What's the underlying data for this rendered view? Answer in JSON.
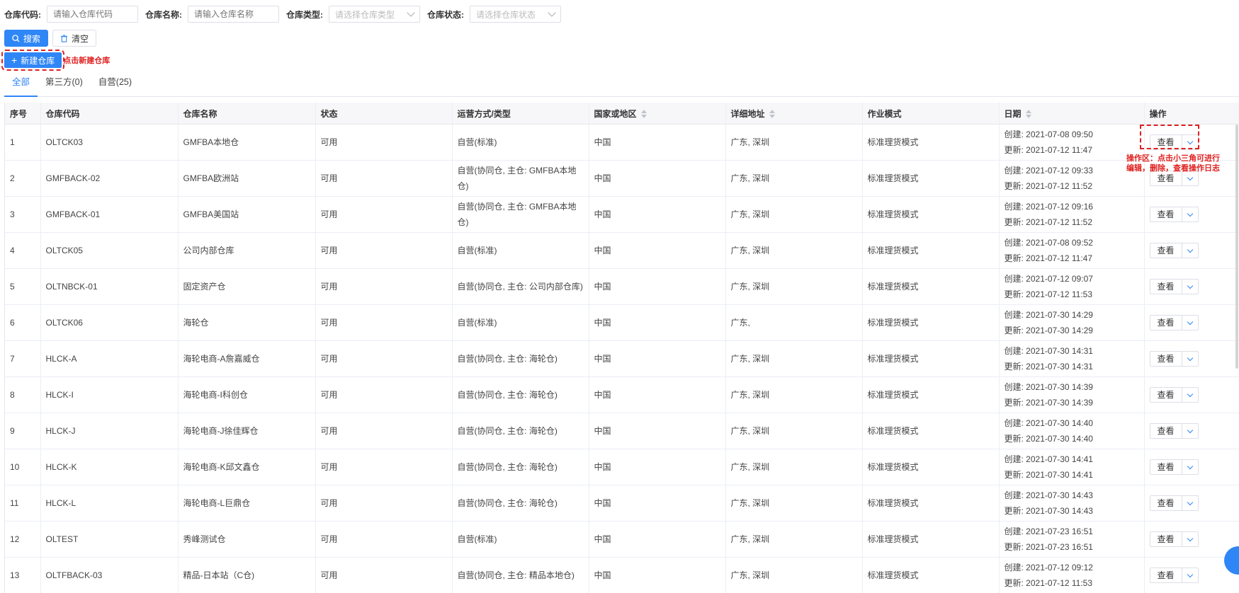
{
  "filters": {
    "code_label": "仓库代码:",
    "code_placeholder": "请输入仓库代码",
    "name_label": "仓库名称:",
    "name_placeholder": "请输入仓库名称",
    "type_label": "仓库类型:",
    "type_placeholder": "请选择仓库类型",
    "status_label": "仓库状态:",
    "status_placeholder": "请选择仓库状态"
  },
  "actions": {
    "search_label": "搜索",
    "clear_label": "清空",
    "new_label": "新建仓库",
    "new_note": "点击新建仓库"
  },
  "tabs": [
    {
      "label": "全部"
    },
    {
      "label": "第三方(0)"
    },
    {
      "label": "自营(25)"
    }
  ],
  "table": {
    "headers": [
      "序号",
      "仓库代码",
      "仓库名称",
      "状态",
      "运营方式/类型",
      "国家或地区",
      "详细地址",
      "作业模式",
      "日期",
      "操作"
    ],
    "view_label": "查看",
    "op_note_line1": "操作区：点击小三角可进行",
    "op_note_line2": "编辑，删除，查看操作日志",
    "rows": [
      {
        "no": "1",
        "code": "OLTCK03",
        "name": "GMFBA本地仓",
        "status": "可用",
        "type": "自营(标准)",
        "country": "中国",
        "addr": "广东, 深圳",
        "mode": "标准理货模式",
        "created": "创建: 2021-07-08 09:50",
        "updated": "更新: 2021-07-12 11:47"
      },
      {
        "no": "2",
        "code": "GMFBACK-02",
        "name": "GMFBA欧洲站",
        "status": "可用",
        "type": "自营(协同仓, 主仓: GMFBA本地仓)",
        "country": "中国",
        "addr": "广东, 深圳",
        "mode": "标准理货模式",
        "created": "创建: 2021-07-12 09:33",
        "updated": "更新: 2021-07-12 11:52"
      },
      {
        "no": "3",
        "code": "GMFBACK-01",
        "name": "GMFBA美国站",
        "status": "可用",
        "type": "自营(协同仓, 主仓: GMFBA本地仓)",
        "country": "中国",
        "addr": "广东, 深圳",
        "mode": "标准理货模式",
        "created": "创建: 2021-07-12 09:16",
        "updated": "更新: 2021-07-12 11:52"
      },
      {
        "no": "4",
        "code": "OLTCK05",
        "name": "公司内部仓库",
        "status": "可用",
        "type": "自营(标准)",
        "country": "中国",
        "addr": "广东, 深圳",
        "mode": "标准理货模式",
        "created": "创建: 2021-07-08 09:52",
        "updated": "更新: 2021-07-12 11:47"
      },
      {
        "no": "5",
        "code": "OLTNBCK-01",
        "name": "固定资产仓",
        "status": "可用",
        "type": "自营(协同仓, 主仓: 公司内部仓库)",
        "country": "中国",
        "addr": "广东, 深圳",
        "mode": "标准理货模式",
        "created": "创建: 2021-07-12 09:07",
        "updated": "更新: 2021-07-12 11:53"
      },
      {
        "no": "6",
        "code": "OLTCK06",
        "name": "海轮仓",
        "status": "可用",
        "type": "自营(标准)",
        "country": "中国",
        "addr": "广东,",
        "mode": "标准理货模式",
        "created": "创建: 2021-07-30 14:29",
        "updated": "更新: 2021-07-30 14:29"
      },
      {
        "no": "7",
        "code": "HLCK-A",
        "name": "海轮电商-A詹嘉威仓",
        "status": "可用",
        "type": "自营(协同仓, 主仓: 海轮仓)",
        "country": "中国",
        "addr": "广东, 深圳",
        "mode": "标准理货模式",
        "created": "创建: 2021-07-30 14:31",
        "updated": "更新: 2021-07-30 14:31"
      },
      {
        "no": "8",
        "code": "HLCK-I",
        "name": "海轮电商-I科创仓",
        "status": "可用",
        "type": "自营(协同仓, 主仓: 海轮仓)",
        "country": "中国",
        "addr": "广东, 深圳",
        "mode": "标准理货模式",
        "created": "创建: 2021-07-30 14:39",
        "updated": "更新: 2021-07-30 14:39"
      },
      {
        "no": "9",
        "code": "HLCK-J",
        "name": "海轮电商-J徐佳辉仓",
        "status": "可用",
        "type": "自营(协同仓, 主仓: 海轮仓)",
        "country": "中国",
        "addr": "广东, 深圳",
        "mode": "标准理货模式",
        "created": "创建: 2021-07-30 14:40",
        "updated": "更新: 2021-07-30 14:40"
      },
      {
        "no": "10",
        "code": "HLCK-K",
        "name": "海轮电商-K邱文鑫仓",
        "status": "可用",
        "type": "自营(协同仓, 主仓: 海轮仓)",
        "country": "中国",
        "addr": "广东, 深圳",
        "mode": "标准理货模式",
        "created": "创建: 2021-07-30 14:41",
        "updated": "更新: 2021-07-30 14:41"
      },
      {
        "no": "11",
        "code": "HLCK-L",
        "name": "海轮电商-L巨鼎仓",
        "status": "可用",
        "type": "自营(协同仓, 主仓: 海轮仓)",
        "country": "中国",
        "addr": "广东, 深圳",
        "mode": "标准理货模式",
        "created": "创建: 2021-07-30 14:43",
        "updated": "更新: 2021-07-30 14:43"
      },
      {
        "no": "12",
        "code": "OLTEST",
        "name": "秀峰测试仓",
        "status": "可用",
        "type": "自营(标准)",
        "country": "中国",
        "addr": "广东, 深圳",
        "mode": "标准理货模式",
        "created": "创建: 2021-07-23 16:51",
        "updated": "更新: 2021-07-23 16:51"
      },
      {
        "no": "13",
        "code": "OLTFBACK-03",
        "name": "精品-日本站（C仓)",
        "status": "可用",
        "type": "自营(协同仓, 主仓: 精品本地仓)",
        "country": "中国",
        "addr": "广东, 深圳",
        "mode": "标准理货模式",
        "created": "创建: 2021-07-12 09:12",
        "updated": "更新: 2021-07-12 11:53"
      }
    ]
  }
}
